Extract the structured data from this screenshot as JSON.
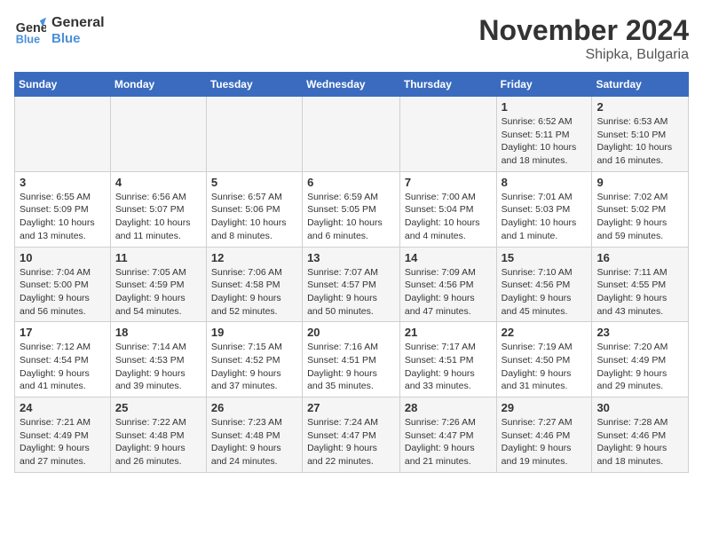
{
  "header": {
    "logo_line1": "General",
    "logo_line2": "Blue",
    "month": "November 2024",
    "location": "Shipka, Bulgaria"
  },
  "weekdays": [
    "Sunday",
    "Monday",
    "Tuesday",
    "Wednesday",
    "Thursday",
    "Friday",
    "Saturday"
  ],
  "weeks": [
    [
      {
        "day": "",
        "detail": ""
      },
      {
        "day": "",
        "detail": ""
      },
      {
        "day": "",
        "detail": ""
      },
      {
        "day": "",
        "detail": ""
      },
      {
        "day": "",
        "detail": ""
      },
      {
        "day": "1",
        "detail": "Sunrise: 6:52 AM\nSunset: 5:11 PM\nDaylight: 10 hours and 18 minutes."
      },
      {
        "day": "2",
        "detail": "Sunrise: 6:53 AM\nSunset: 5:10 PM\nDaylight: 10 hours and 16 minutes."
      }
    ],
    [
      {
        "day": "3",
        "detail": "Sunrise: 6:55 AM\nSunset: 5:09 PM\nDaylight: 10 hours and 13 minutes."
      },
      {
        "day": "4",
        "detail": "Sunrise: 6:56 AM\nSunset: 5:07 PM\nDaylight: 10 hours and 11 minutes."
      },
      {
        "day": "5",
        "detail": "Sunrise: 6:57 AM\nSunset: 5:06 PM\nDaylight: 10 hours and 8 minutes."
      },
      {
        "day": "6",
        "detail": "Sunrise: 6:59 AM\nSunset: 5:05 PM\nDaylight: 10 hours and 6 minutes."
      },
      {
        "day": "7",
        "detail": "Sunrise: 7:00 AM\nSunset: 5:04 PM\nDaylight: 10 hours and 4 minutes."
      },
      {
        "day": "8",
        "detail": "Sunrise: 7:01 AM\nSunset: 5:03 PM\nDaylight: 10 hours and 1 minute."
      },
      {
        "day": "9",
        "detail": "Sunrise: 7:02 AM\nSunset: 5:02 PM\nDaylight: 9 hours and 59 minutes."
      }
    ],
    [
      {
        "day": "10",
        "detail": "Sunrise: 7:04 AM\nSunset: 5:00 PM\nDaylight: 9 hours and 56 minutes."
      },
      {
        "day": "11",
        "detail": "Sunrise: 7:05 AM\nSunset: 4:59 PM\nDaylight: 9 hours and 54 minutes."
      },
      {
        "day": "12",
        "detail": "Sunrise: 7:06 AM\nSunset: 4:58 PM\nDaylight: 9 hours and 52 minutes."
      },
      {
        "day": "13",
        "detail": "Sunrise: 7:07 AM\nSunset: 4:57 PM\nDaylight: 9 hours and 50 minutes."
      },
      {
        "day": "14",
        "detail": "Sunrise: 7:09 AM\nSunset: 4:56 PM\nDaylight: 9 hours and 47 minutes."
      },
      {
        "day": "15",
        "detail": "Sunrise: 7:10 AM\nSunset: 4:56 PM\nDaylight: 9 hours and 45 minutes."
      },
      {
        "day": "16",
        "detail": "Sunrise: 7:11 AM\nSunset: 4:55 PM\nDaylight: 9 hours and 43 minutes."
      }
    ],
    [
      {
        "day": "17",
        "detail": "Sunrise: 7:12 AM\nSunset: 4:54 PM\nDaylight: 9 hours and 41 minutes."
      },
      {
        "day": "18",
        "detail": "Sunrise: 7:14 AM\nSunset: 4:53 PM\nDaylight: 9 hours and 39 minutes."
      },
      {
        "day": "19",
        "detail": "Sunrise: 7:15 AM\nSunset: 4:52 PM\nDaylight: 9 hours and 37 minutes."
      },
      {
        "day": "20",
        "detail": "Sunrise: 7:16 AM\nSunset: 4:51 PM\nDaylight: 9 hours and 35 minutes."
      },
      {
        "day": "21",
        "detail": "Sunrise: 7:17 AM\nSunset: 4:51 PM\nDaylight: 9 hours and 33 minutes."
      },
      {
        "day": "22",
        "detail": "Sunrise: 7:19 AM\nSunset: 4:50 PM\nDaylight: 9 hours and 31 minutes."
      },
      {
        "day": "23",
        "detail": "Sunrise: 7:20 AM\nSunset: 4:49 PM\nDaylight: 9 hours and 29 minutes."
      }
    ],
    [
      {
        "day": "24",
        "detail": "Sunrise: 7:21 AM\nSunset: 4:49 PM\nDaylight: 9 hours and 27 minutes."
      },
      {
        "day": "25",
        "detail": "Sunrise: 7:22 AM\nSunset: 4:48 PM\nDaylight: 9 hours and 26 minutes."
      },
      {
        "day": "26",
        "detail": "Sunrise: 7:23 AM\nSunset: 4:48 PM\nDaylight: 9 hours and 24 minutes."
      },
      {
        "day": "27",
        "detail": "Sunrise: 7:24 AM\nSunset: 4:47 PM\nDaylight: 9 hours and 22 minutes."
      },
      {
        "day": "28",
        "detail": "Sunrise: 7:26 AM\nSunset: 4:47 PM\nDaylight: 9 hours and 21 minutes."
      },
      {
        "day": "29",
        "detail": "Sunrise: 7:27 AM\nSunset: 4:46 PM\nDaylight: 9 hours and 19 minutes."
      },
      {
        "day": "30",
        "detail": "Sunrise: 7:28 AM\nSunset: 4:46 PM\nDaylight: 9 hours and 18 minutes."
      }
    ]
  ]
}
